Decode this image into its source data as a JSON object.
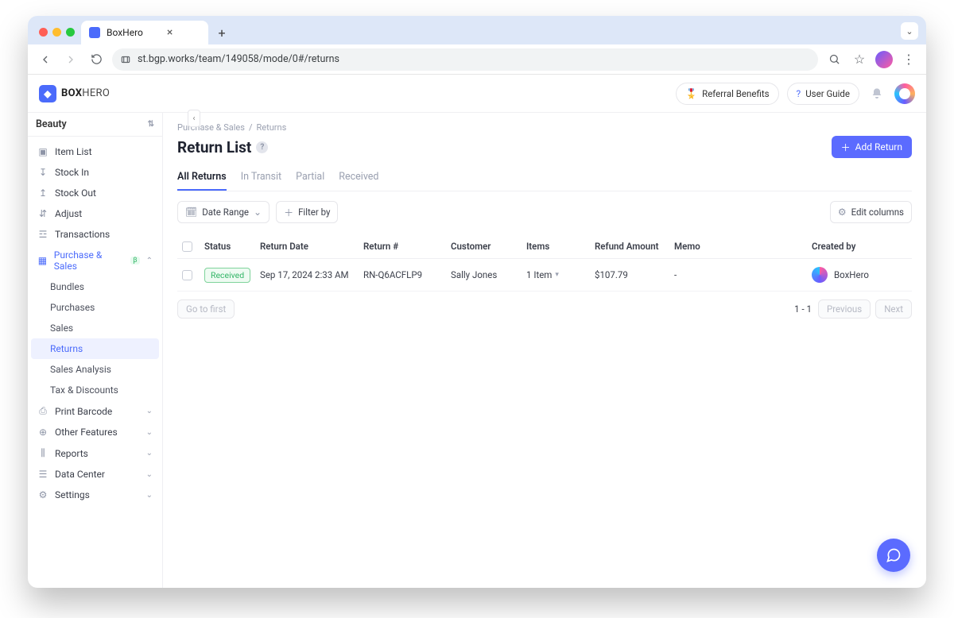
{
  "browser": {
    "tab_title": "BoxHero",
    "url_display": "st.bgp.works/team/149058/mode/0#/returns"
  },
  "app": {
    "logo_bold": "BOX",
    "logo_thin": "HERO",
    "referral_btn": "Referral Benefits",
    "guide_btn": "User Guide"
  },
  "sidebar": {
    "team": "Beauty",
    "items": [
      {
        "label": "Item List",
        "icon": "inventory"
      },
      {
        "label": "Stock In",
        "icon": "down"
      },
      {
        "label": "Stock Out",
        "icon": "up"
      },
      {
        "label": "Adjust",
        "icon": "swap"
      },
      {
        "label": "Transactions",
        "icon": "scan"
      }
    ],
    "ps": {
      "label": "Purchase & Sales",
      "beta": "β"
    },
    "ps_children": [
      "Bundles",
      "Purchases",
      "Sales",
      "Returns",
      "Sales Analysis",
      "Tax & Discounts"
    ],
    "tail": [
      {
        "label": "Print Barcode"
      },
      {
        "label": "Other Features"
      },
      {
        "label": "Reports"
      },
      {
        "label": "Data Center"
      },
      {
        "label": "Settings"
      }
    ]
  },
  "main": {
    "breadcrumb": [
      "Purchase & Sales",
      "Returns"
    ],
    "title": "Return List",
    "add_btn": "Add Return",
    "tabs": [
      "All Returns",
      "In Transit",
      "Partial",
      "Received"
    ],
    "date_range": "Date Range",
    "filter_by": "Filter by",
    "edit_cols": "Edit columns",
    "columns": [
      "Status",
      "Return Date",
      "Return #",
      "Customer",
      "Items",
      "Refund Amount",
      "Memo",
      "Created by"
    ],
    "row": {
      "status": "Received",
      "date": "Sep 17, 2024 2:33 AM",
      "num": "RN-Q6ACFLP9",
      "customer": "Sally Jones",
      "items": "1 Item",
      "refund": "$107.79",
      "memo": "-",
      "creator": "BoxHero"
    },
    "pager": {
      "first": "Go to first",
      "range": "1 - 1",
      "prev": "Previous",
      "next": "Next"
    }
  }
}
